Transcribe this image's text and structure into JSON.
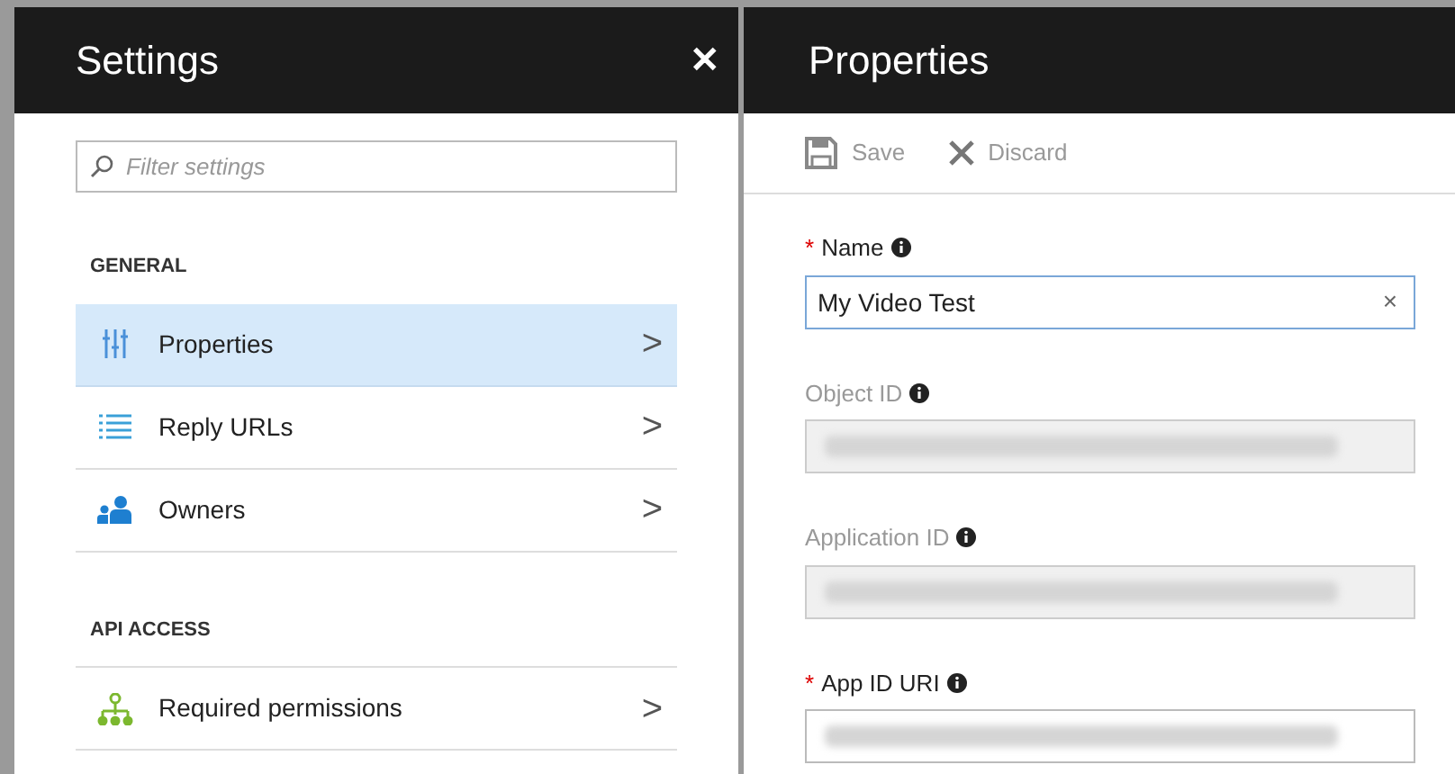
{
  "settings_panel": {
    "title": "Settings",
    "close": "✕",
    "filter": {
      "placeholder": "Filter settings"
    },
    "sections": [
      {
        "heading": "GENERAL",
        "items": [
          {
            "label": "Properties",
            "kind": "sliders",
            "selected": true,
            "chevron": ">"
          },
          {
            "label": "Reply URLs",
            "kind": "list",
            "selected": false,
            "chevron": ">"
          },
          {
            "label": "Owners",
            "kind": "people",
            "selected": false,
            "chevron": ">"
          }
        ]
      },
      {
        "heading": "API ACCESS",
        "items": [
          {
            "label": "Required permissions",
            "kind": "tree",
            "selected": false,
            "chevron": ">"
          }
        ]
      }
    ]
  },
  "properties_panel": {
    "title": "Properties",
    "toolbar": [
      {
        "kind": "save",
        "label": "Save",
        "disabled": true
      },
      {
        "kind": "discard",
        "label": "Discard",
        "disabled": true
      }
    ],
    "fields": [
      {
        "label": "Name",
        "required_mark": "*",
        "readonly": false,
        "value": "My Video Test",
        "clear": "×"
      },
      {
        "label": "Object ID",
        "readonly": true
      },
      {
        "label": "Application ID",
        "readonly": true
      },
      {
        "label": "App ID URI",
        "required_mark": "*",
        "readonly": false
      }
    ]
  }
}
